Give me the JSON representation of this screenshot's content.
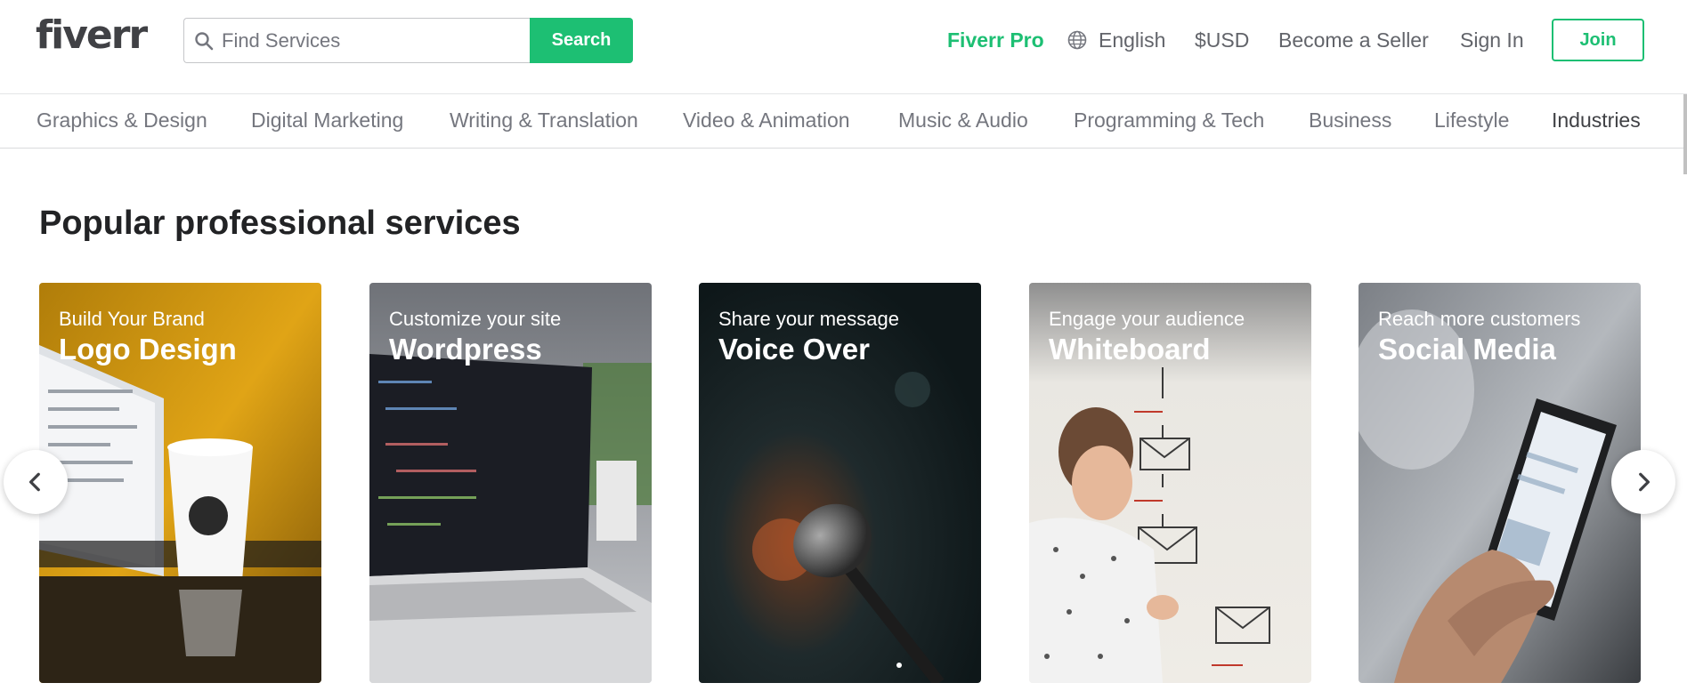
{
  "header": {
    "logo": "fiverr",
    "search_placeholder": "Find Services",
    "search_button": "Search",
    "nav": {
      "pro": "Fiverr Pro",
      "language": "English",
      "currency": "$USD",
      "become_seller": "Become a Seller",
      "sign_in": "Sign In",
      "join": "Join"
    }
  },
  "categories": [
    "Graphics & Design",
    "Digital Marketing",
    "Writing & Translation",
    "Video & Animation",
    "Music & Audio",
    "Programming & Tech",
    "Business",
    "Lifestyle",
    "Industries"
  ],
  "main": {
    "title": "Popular professional services",
    "cards": [
      {
        "subtitle": "Build Your Brand",
        "title": "Logo Design"
      },
      {
        "subtitle": "Customize your site",
        "title": "Wordpress"
      },
      {
        "subtitle": "Share your message",
        "title": "Voice Over"
      },
      {
        "subtitle": "Engage your audience",
        "title": "Whiteboard"
      },
      {
        "subtitle": "Reach more customers",
        "title": "Social Media"
      }
    ]
  },
  "colors": {
    "brand_green": "#1dbf73",
    "text_dark": "#222325",
    "text_gray": "#74767e"
  },
  "icons": {
    "search": "search-icon",
    "globe": "globe-icon",
    "prev": "chevron-left-icon",
    "next": "chevron-right-icon"
  }
}
